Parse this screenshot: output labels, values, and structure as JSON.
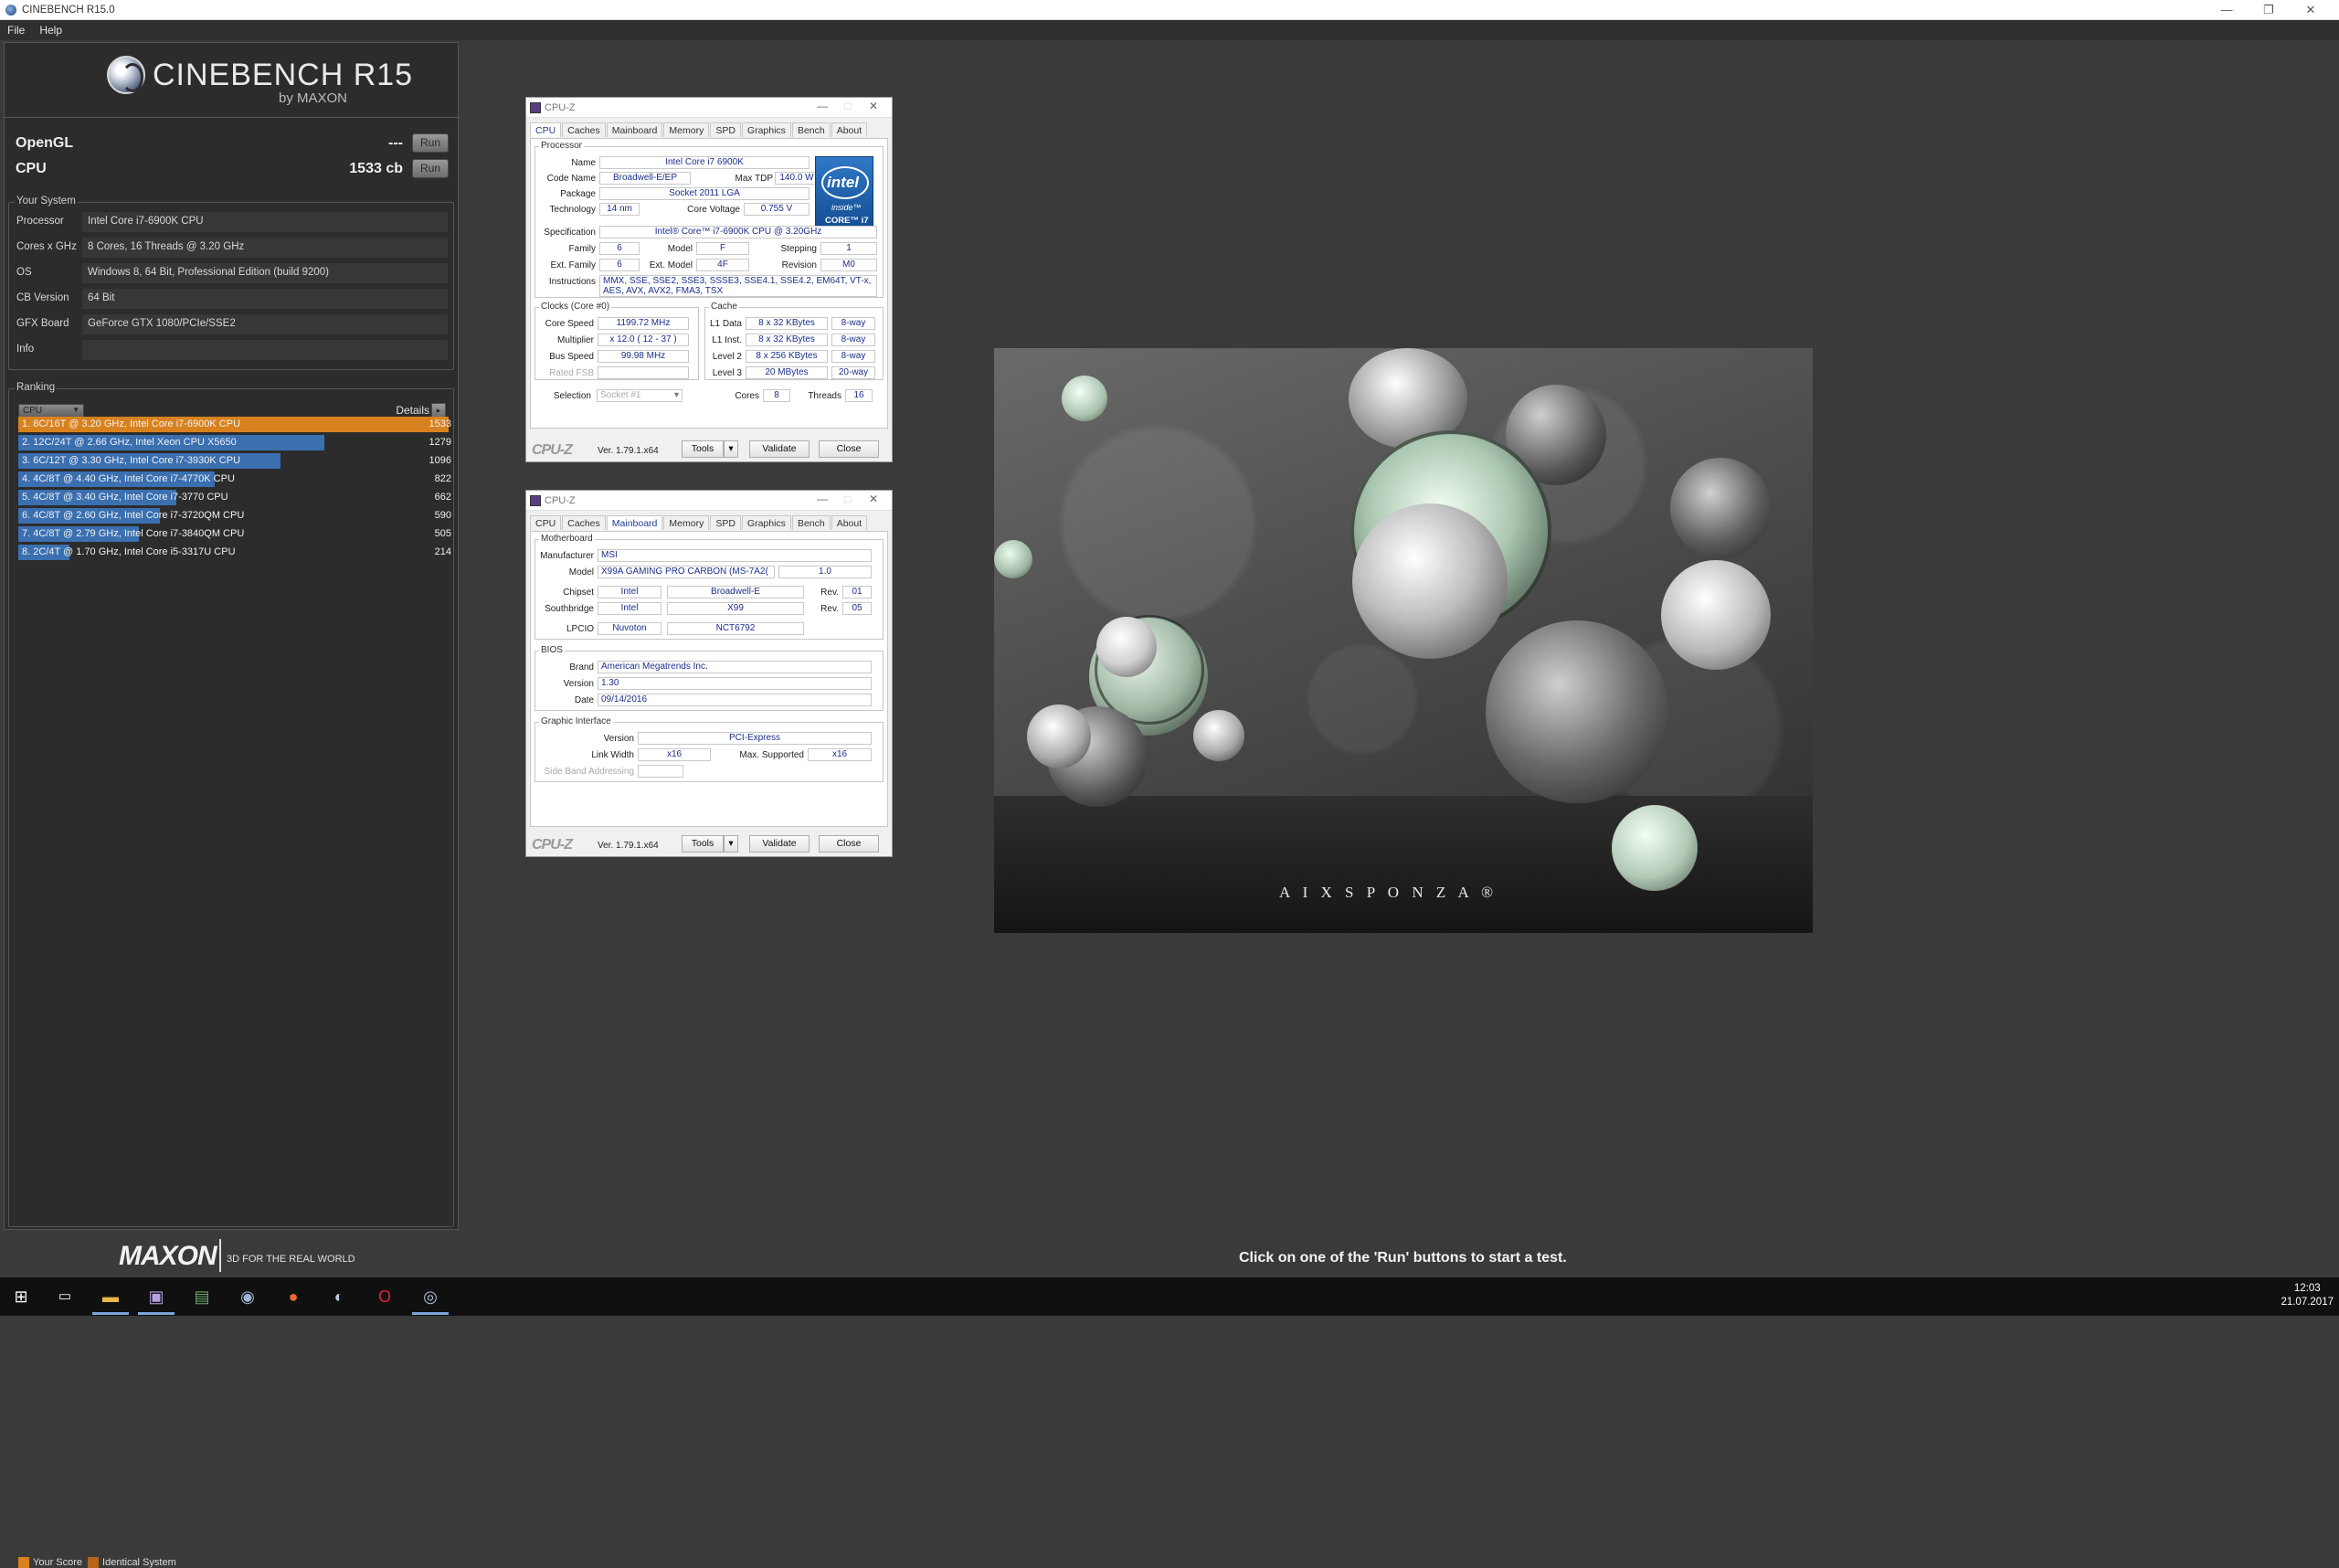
{
  "window": {
    "title": "CINEBENCH R15.0",
    "minimize": "—",
    "restore": "❐",
    "close": "✕"
  },
  "menu": [
    "File",
    "Help"
  ],
  "brand": {
    "name": "CINEBENCH R15",
    "by": "by MAXON"
  },
  "tests": [
    {
      "label": "OpenGL",
      "value": "---",
      "button": "Run"
    },
    {
      "label": "CPU",
      "value": "1533 cb",
      "button": "Run"
    }
  ],
  "your_system": {
    "title": "Your System",
    "rows": [
      {
        "key": "Processor",
        "value": "Intel Core i7-6900K CPU"
      },
      {
        "key": "Cores x GHz",
        "value": "8 Cores, 16 Threads @ 3.20 GHz"
      },
      {
        "key": "OS",
        "value": "Windows 8, 64 Bit, Professional Edition (build 9200)"
      },
      {
        "key": "CB Version",
        "value": "64 Bit"
      },
      {
        "key": "GFX Board",
        "value": "GeForce GTX 1080/PCIe/SSE2"
      },
      {
        "key": "Info",
        "value": ""
      }
    ]
  },
  "ranking": {
    "title": "Ranking",
    "select": "CPU",
    "details": "Details",
    "details_btn": "▸",
    "max_score": 1533,
    "rows": [
      {
        "text": "1. 8C/16T @ 3.20 GHz, Intel Core i7-6900K CPU",
        "score": 1533,
        "mine": true
      },
      {
        "text": "2. 12C/24T @ 2.66 GHz, Intel Xeon CPU X5650",
        "score": 1279,
        "mine": false
      },
      {
        "text": "3. 6C/12T @ 3.30 GHz,  Intel Core i7-3930K CPU",
        "score": 1096,
        "mine": false
      },
      {
        "text": "4. 4C/8T @ 4.40 GHz, Intel Core i7-4770K CPU",
        "score": 822,
        "mine": false
      },
      {
        "text": "5. 4C/8T @ 3.40 GHz,  Intel Core i7-3770 CPU",
        "score": 662,
        "mine": false
      },
      {
        "text": "6. 4C/8T @ 2.60 GHz, Intel Core i7-3720QM CPU",
        "score": 590,
        "mine": false
      },
      {
        "text": "7. 4C/8T @ 2.79 GHz,  Intel Core i7-3840QM CPU",
        "score": 505,
        "mine": false
      },
      {
        "text": "8. 2C/4T @ 1.70 GHz,  Intel Core i5-3317U CPU",
        "score": 214,
        "mine": false
      }
    ],
    "legend": {
      "your_score": "Your Score",
      "identical": "Identical System"
    }
  },
  "footer": {
    "logo": "MAXON",
    "tagline": "3D FOR THE REAL WORLD"
  },
  "status": "Click on one of the 'Run' buttons to start a test.",
  "render": {
    "watermark": "A I X S P O N Z A ®"
  },
  "cpuz1": {
    "title": "CPU-Z",
    "tabs": [
      "CPU",
      "Caches",
      "Mainboard",
      "Memory",
      "SPD",
      "Graphics",
      "Bench",
      "About"
    ],
    "active_tab": "CPU",
    "processor_legend": "Processor",
    "name_k": "Name",
    "name": "Intel Core i7 6900K",
    "codename_k": "Code Name",
    "codename": "Broadwell-E/EP",
    "maxtdp_k": "Max TDP",
    "maxtdp": "140.0 W",
    "package_k": "Package",
    "package": "Socket 2011 LGA",
    "tech_k": "Technology",
    "tech": "14 nm",
    "voltage_k": "Core Voltage",
    "voltage": "0.755 V",
    "spec_k": "Specification",
    "spec": "Intel® Core™ i7-6900K CPU @ 3.20GHz",
    "family_k": "Family",
    "family": "6",
    "model_k": "Model",
    "model": "F",
    "stepping_k": "Stepping",
    "stepping": "1",
    "extfamily_k": "Ext. Family",
    "extfamily": "6",
    "extmodel_k": "Ext. Model",
    "extmodel": "4F",
    "revision_k": "Revision",
    "revision": "M0",
    "instr_k": "Instructions",
    "instr": "MMX, SSE, SSE2, SSE3, SSSE3, SSE4.1, SSE4.2, EM64T, VT-x, AES, AVX, AVX2, FMA3, TSX",
    "intel": {
      "word": "intel",
      "inside": "inside™",
      "core": "CORE™ i7"
    },
    "clocks_legend": "Clocks (Core #0)",
    "corespeed_k": "Core Speed",
    "corespeed": "1199.72 MHz",
    "mult_k": "Multiplier",
    "mult": "x 12.0 ( 12 - 37 )",
    "bus_k": "Bus Speed",
    "bus": "99.98 MHz",
    "fsb_k": "Rated FSB",
    "fsb": "",
    "cache_legend": "Cache",
    "l1d_k": "L1 Data",
    "l1d": "8 x 32 KBytes",
    "l1d_w": "8-way",
    "l1i_k": "L1 Inst.",
    "l1i": "8 x 32 KBytes",
    "l1i_w": "8-way",
    "l2_k": "Level 2",
    "l2": "8 x 256 KBytes",
    "l2_w": "8-way",
    "l3_k": "Level 3",
    "l3": "20 MBytes",
    "l3_w": "20-way",
    "selection_k": "Selection",
    "selection": "Socket #1",
    "cores_k": "Cores",
    "cores": "8",
    "threads_k": "Threads",
    "threads": "16",
    "logo": "CPU-Z",
    "ver": "Ver. 1.79.1.x64",
    "tools": "Tools",
    "validate": "Validate",
    "close": "Close"
  },
  "cpuz2": {
    "title": "CPU-Z",
    "tabs": [
      "CPU",
      "Caches",
      "Mainboard",
      "Memory",
      "SPD",
      "Graphics",
      "Bench",
      "About"
    ],
    "active_tab": "Mainboard",
    "mb_legend": "Motherboard",
    "manuf_k": "Manufacturer",
    "manuf": "MSI",
    "model_k": "Model",
    "model": "X99A GAMING PRO CARBON (MS-7A2(",
    "model_rev": "1.0",
    "chipset_k": "Chipset",
    "chipset_v": "Intel",
    "chipset_n": "Broadwell-E",
    "chipset_rev_k": "Rev.",
    "chipset_rev": "01",
    "south_k": "Southbridge",
    "south_v": "Intel",
    "south_n": "X99",
    "south_rev_k": "Rev.",
    "south_rev": "05",
    "lpcio_k": "LPCIO",
    "lpcio_v": "Nuvoton",
    "lpcio_n": "NCT6792",
    "bios_legend": "BIOS",
    "brand_k": "Brand",
    "brand": "American Megatrends Inc.",
    "version_k": "Version",
    "version": "1.30",
    "date_k": "Date",
    "date": "09/14/2016",
    "gi_legend": "Graphic Interface",
    "giver_k": "Version",
    "giver": "PCI-Express",
    "lw_k": "Link Width",
    "lw": "x16",
    "ms_k": "Max. Supported",
    "ms": "x16",
    "sba_k": "Side Band Addressing",
    "sba": "",
    "logo": "CPU-Z",
    "ver": "Ver. 1.79.1.x64",
    "tools": "Tools",
    "validate": "Validate",
    "close": "Close"
  },
  "taskbar": {
    "time": "12:03",
    "date": "21.07.2017"
  }
}
